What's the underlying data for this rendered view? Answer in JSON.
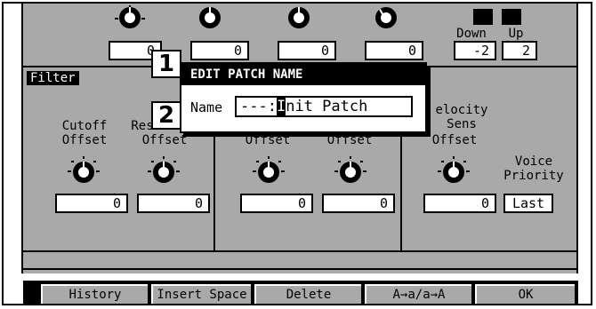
{
  "top_values": [
    "0",
    "0",
    "0",
    "0",
    "-2",
    "2"
  ],
  "top_labels": {
    "down": "Down",
    "up": "Up"
  },
  "section": {
    "filter": "Filter"
  },
  "params": [
    {
      "line1": "Cutoff",
      "line2": "Offset",
      "value": "0"
    },
    {
      "line1": "Res",
      "line2": "Offset",
      "value": "0"
    },
    {
      "line1": "",
      "line2": "Offset",
      "value": "0"
    },
    {
      "line1": "",
      "line2": "Offset",
      "value": "0"
    },
    {
      "line1": "elocity",
      "line1b": "Sens",
      "line2": "Offset",
      "value": "0"
    }
  ],
  "voice_priority": {
    "line1": "Voice",
    "line2": "Priority",
    "value": "Last"
  },
  "dialog": {
    "title": "EDIT PATCH NAME",
    "name_label": "Name",
    "name_prefix": "---:",
    "name_cursor": "I",
    "name_rest": "nit Patch"
  },
  "callouts": [
    "1",
    "2"
  ],
  "function_bar": [
    "History",
    "Insert Space",
    "Delete",
    "A→a/a→A",
    "OK"
  ]
}
